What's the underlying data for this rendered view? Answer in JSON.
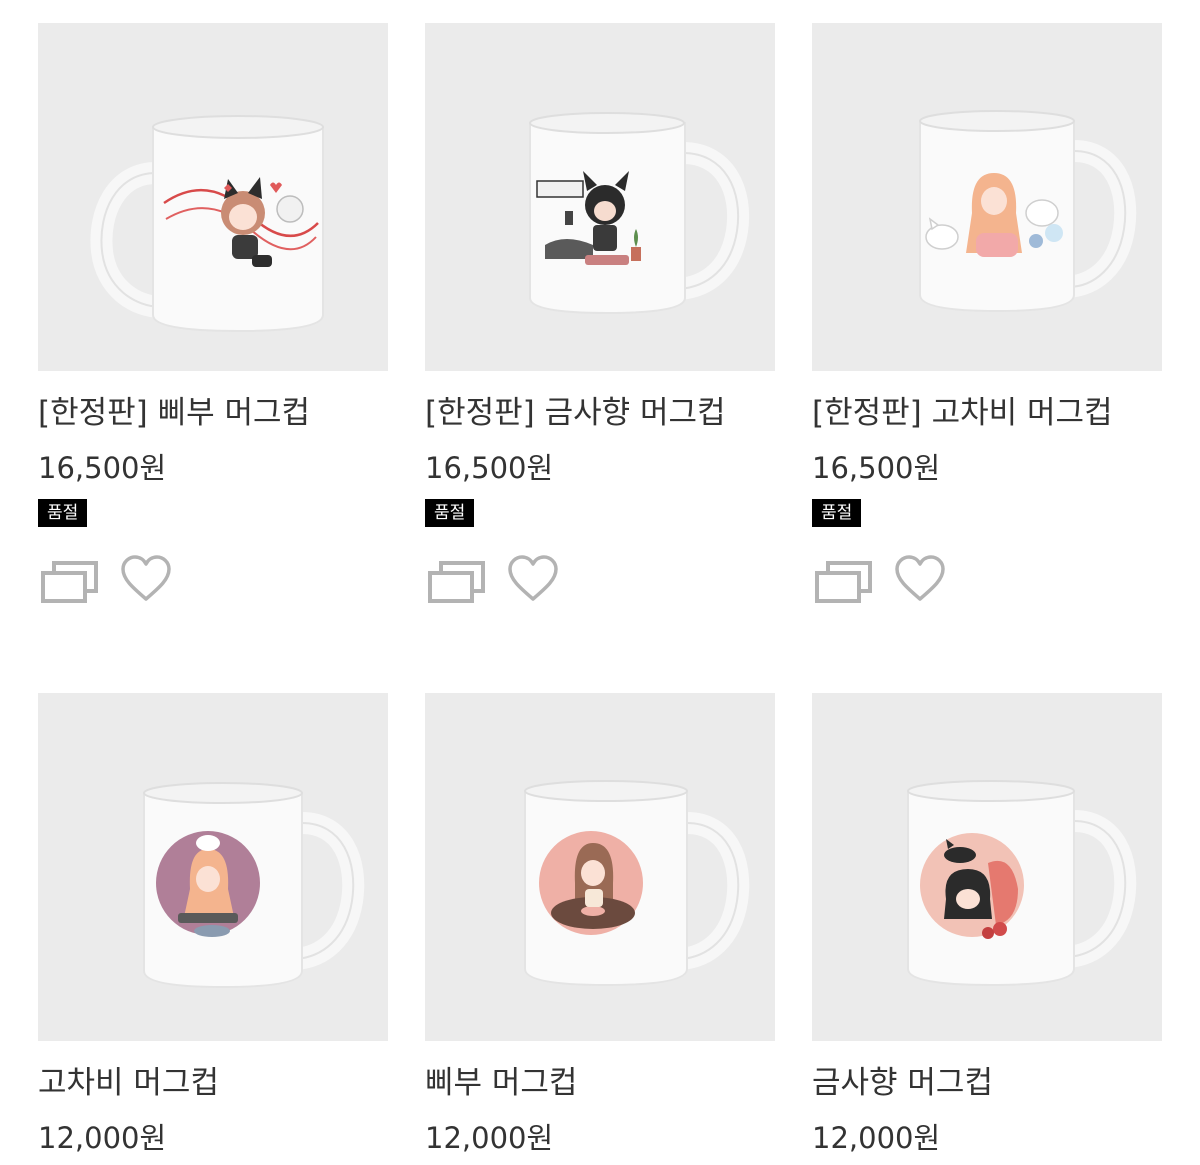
{
  "products": [
    {
      "title": "[한정판] 삐부 머그컵",
      "price": "16,500원",
      "badge": "품절",
      "image": {
        "art": "cat-girl-red-ribbon",
        "handle": "left",
        "accent": "#d84a4a"
      }
    },
    {
      "title": "[한정판] 금사향 머그컵",
      "price": "16,500원",
      "badge": "품절",
      "image": {
        "art": "cat-girl-black-hair-desk",
        "handle": "right",
        "accent": "#2b2b2b"
      }
    },
    {
      "title": "[한정판] 고차비 머그컵",
      "price": "16,500원",
      "badge": "품절",
      "image": {
        "art": "blonde-girl-white-pets",
        "handle": "right",
        "accent": "#f4a6a0"
      }
    },
    {
      "title": "고차비 머그컵",
      "price": "12,000원",
      "image": {
        "art": "blonde-girl-round-mauve",
        "handle": "right",
        "accent": "#b07f98"
      }
    },
    {
      "title": "삐부 머그컵",
      "price": "12,000원",
      "image": {
        "art": "girl-on-donut-round-pink",
        "handle": "right",
        "accent": "#efb0a6"
      }
    },
    {
      "title": "금사향 머그컵",
      "price": "12,000원",
      "image": {
        "art": "black-hair-girl-cat-round-pink",
        "handle": "right",
        "accent": "#f2c2b6"
      }
    }
  ],
  "icons": {
    "copy": "copy-icon",
    "heart": "heart-icon"
  },
  "colors": {
    "text": "#333333",
    "icon": "#b3b3b3",
    "badge_bg": "#000000",
    "thumb_bg": "#ebebeb"
  }
}
